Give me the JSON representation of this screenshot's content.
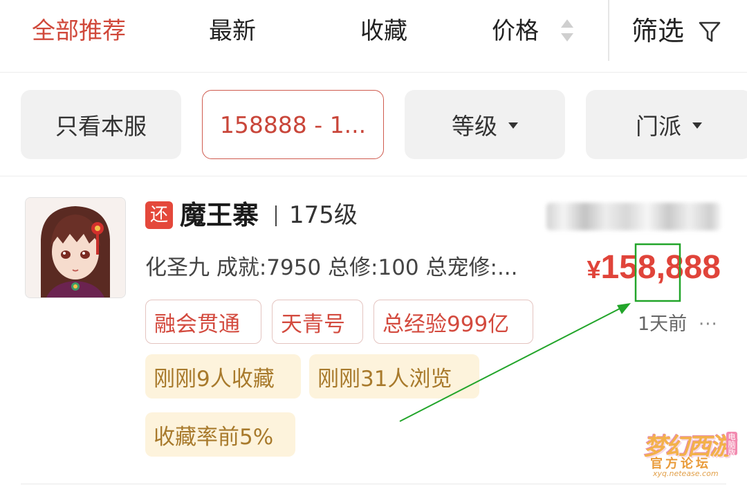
{
  "sort_bar": {
    "tabs": [
      {
        "label": "全部推荐",
        "active": true
      },
      {
        "label": "最新",
        "active": false
      },
      {
        "label": "收藏",
        "active": false
      },
      {
        "label": "价格",
        "active": false
      }
    ],
    "price_sort_icon": "sort-up-down-icon",
    "filter_label": "筛选",
    "filter_icon": "funnel-icon"
  },
  "chips": {
    "same_server": "只看本服",
    "price_range": "158888 - 1...",
    "level": "等级",
    "sect": "门派",
    "dropdown_icon": "caret-down-icon"
  },
  "listing": {
    "badge": "还",
    "name": "魔王寨",
    "level": "175级",
    "summary": "化圣九 成就:7950 总修:100 总宠修:...",
    "price_currency": "¥",
    "price_amount": "158,888",
    "tags_red": [
      "融会贯通",
      "天青号",
      "总经验999亿"
    ],
    "tags_yellow": [
      "刚刚9人收藏",
      "刚刚31人浏览",
      "收藏率前5%"
    ],
    "time": "1天前",
    "more_icon": "ellipsis-icon"
  },
  "watermark": {
    "line1": "梦幻西游",
    "tag": "电脑版",
    "line2": "官方论坛",
    "line3": "xyq.netease.com"
  },
  "colors": {
    "accent_red": "#d0483a",
    "price_red": "#e0443a",
    "tag_yellow_bg": "#fdf3dc",
    "tag_yellow_text": "#a87a2c",
    "annotation_green": "#22a52a"
  }
}
